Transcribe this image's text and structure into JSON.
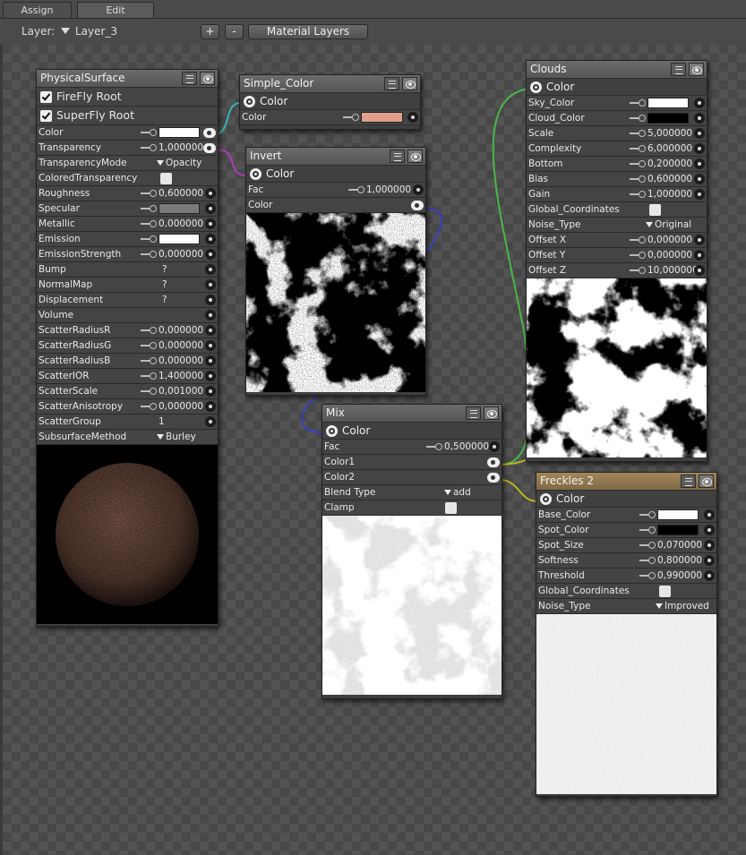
{
  "tabs": [
    {
      "label": "Assign"
    },
    {
      "label": "Edit"
    }
  ],
  "toolbar": {
    "layer_label": "Layer:",
    "layer_value": "Layer_3",
    "plus": "+",
    "minus": "-",
    "material_layers": "Material Layers"
  },
  "nodes": {
    "physical": {
      "title": "PhysicalSurface",
      "roots": [
        "FireFly Root",
        "SuperFly Root"
      ],
      "rows": [
        {
          "label": "Color",
          "value": "",
          "kind": "swatch",
          "color": "#ffffff"
        },
        {
          "label": "Transparency",
          "value": "1,000000"
        },
        {
          "label": "TransparencyMode",
          "value": "Opacity",
          "kind": "dropdown"
        },
        {
          "label": "ColoredTransparency",
          "value": "",
          "kind": "check"
        },
        {
          "label": "Roughness",
          "value": "0,600000"
        },
        {
          "label": "Specular",
          "value": "",
          "kind": "swatch",
          "color": "#7a7a7a"
        },
        {
          "label": "Metallic",
          "value": "0,000000"
        },
        {
          "label": "Emission",
          "value": "",
          "kind": "swatch",
          "color": "#ffffff"
        },
        {
          "label": "EmissionStrength",
          "value": "0,000000"
        },
        {
          "label": "Bump",
          "value": "?"
        },
        {
          "label": "NormalMap",
          "value": "?"
        },
        {
          "label": "Displacement",
          "value": "?"
        },
        {
          "label": "Volume",
          "value": ""
        },
        {
          "label": "ScatterRadiusR",
          "value": "0,000000"
        },
        {
          "label": "ScatterRadiusG",
          "value": "0,000000"
        },
        {
          "label": "ScatterRadiusB",
          "value": "0,000000"
        },
        {
          "label": "ScatterIOR",
          "value": "1,400000"
        },
        {
          "label": "ScatterScale",
          "value": "0,001000"
        },
        {
          "label": "ScatterAnisotropy",
          "value": "0,000000"
        },
        {
          "label": "ScatterGroup",
          "value": "1"
        },
        {
          "label": "SubsurfaceMethod",
          "value": "Burley",
          "kind": "dropdown"
        }
      ]
    },
    "simple_color": {
      "title": "Simple_Color",
      "output": "Color",
      "row_label": "Color",
      "swatch": "#e0a08c"
    },
    "invert": {
      "title": "Invert",
      "output": "Color",
      "rows": [
        {
          "label": "Fac",
          "value": "1,000000"
        },
        {
          "label": "Color",
          "value": ""
        }
      ]
    },
    "mix": {
      "title": "Mix",
      "output": "Color",
      "rows": [
        {
          "label": "Fac",
          "value": "0,500000"
        },
        {
          "label": "Color1",
          "value": ""
        },
        {
          "label": "Color2",
          "value": ""
        },
        {
          "label": "Blend Type",
          "value": "add"
        },
        {
          "label": "Clamp",
          "value": ""
        }
      ]
    },
    "clouds": {
      "title": "Clouds",
      "output": "Color",
      "rows": [
        {
          "label": "Sky_Color",
          "value": "",
          "color": "#ffffff"
        },
        {
          "label": "Cloud_Color",
          "value": "",
          "color": "#000000"
        },
        {
          "label": "Scale",
          "value": "5,000000"
        },
        {
          "label": "Complexity",
          "value": "6,000000"
        },
        {
          "label": "Bottom",
          "value": "0,200000"
        },
        {
          "label": "Bias",
          "value": "0,600000"
        },
        {
          "label": "Gain",
          "value": "1,000000"
        },
        {
          "label": "Global_Coordinates",
          "value": ""
        },
        {
          "label": "Noise_Type",
          "value": "Original"
        },
        {
          "label": "Offset X",
          "value": "0,000000"
        },
        {
          "label": "Offset Y",
          "value": "0,000000"
        },
        {
          "label": "Offset Z",
          "value": "10,000000"
        }
      ]
    },
    "freckles": {
      "title": "Freckles 2",
      "output": "Color",
      "rows": [
        {
          "label": "Base_Color",
          "value": "",
          "color": "#ffffff"
        },
        {
          "label": "Spot_Color",
          "value": "",
          "color": "#000000"
        },
        {
          "label": "Spot_Size",
          "value": "0,070000"
        },
        {
          "label": "Softness",
          "value": "0,800000"
        },
        {
          "label": "Threshold",
          "value": "0,990000"
        },
        {
          "label": "Global_Coordinates",
          "value": ""
        },
        {
          "label": "Noise_Type",
          "value": "Improved"
        }
      ]
    }
  },
  "wire_colors": {
    "cyan": "#3bb3b3",
    "magenta": "#b13cb5",
    "blue": "#3840c0",
    "green": "#49b64a",
    "yellow": "#b8b820"
  }
}
